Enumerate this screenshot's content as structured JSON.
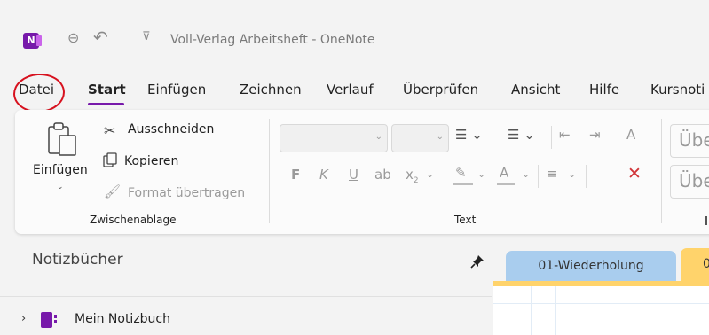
{
  "window": {
    "title": "Voll-Verlag Arbeitsheft - OneNote",
    "app_logo": "N"
  },
  "tabs": [
    {
      "label": "Datei",
      "highlighted_annotation": true
    },
    {
      "label": "Start",
      "active": true
    },
    {
      "label": "Einfügen"
    },
    {
      "label": "Zeichnen"
    },
    {
      "label": "Verlauf"
    },
    {
      "label": "Überprüfen"
    },
    {
      "label": "Ansicht"
    },
    {
      "label": "Hilfe"
    },
    {
      "label": "Kursnoti"
    }
  ],
  "ribbon": {
    "clipboard": {
      "paste_label": "Einfügen",
      "cut_label": "Ausschneiden",
      "copy_label": "Kopieren",
      "format_painter_label": "Format übertragen",
      "group_label": "Zwischenablage"
    },
    "text": {
      "group_label": "Text",
      "bold": "F",
      "italic": "K",
      "underline": "U",
      "strike": "ab",
      "subscript": "x",
      "subscript_small": "2"
    },
    "styles": {
      "row1": "Übe",
      "row2": "Übe",
      "group_label": ""
    }
  },
  "notebooks_pane": {
    "header": "Notizbücher",
    "items": [
      {
        "label": "Mein Notizbuch"
      }
    ]
  },
  "section_tabs": [
    {
      "label": "01-Wiederholung",
      "color": "#a9cdee"
    },
    {
      "label": "0",
      "color": "#ffd36b"
    }
  ],
  "colors": {
    "accent": "#7719aa",
    "annotation_red": "#d7111e"
  }
}
